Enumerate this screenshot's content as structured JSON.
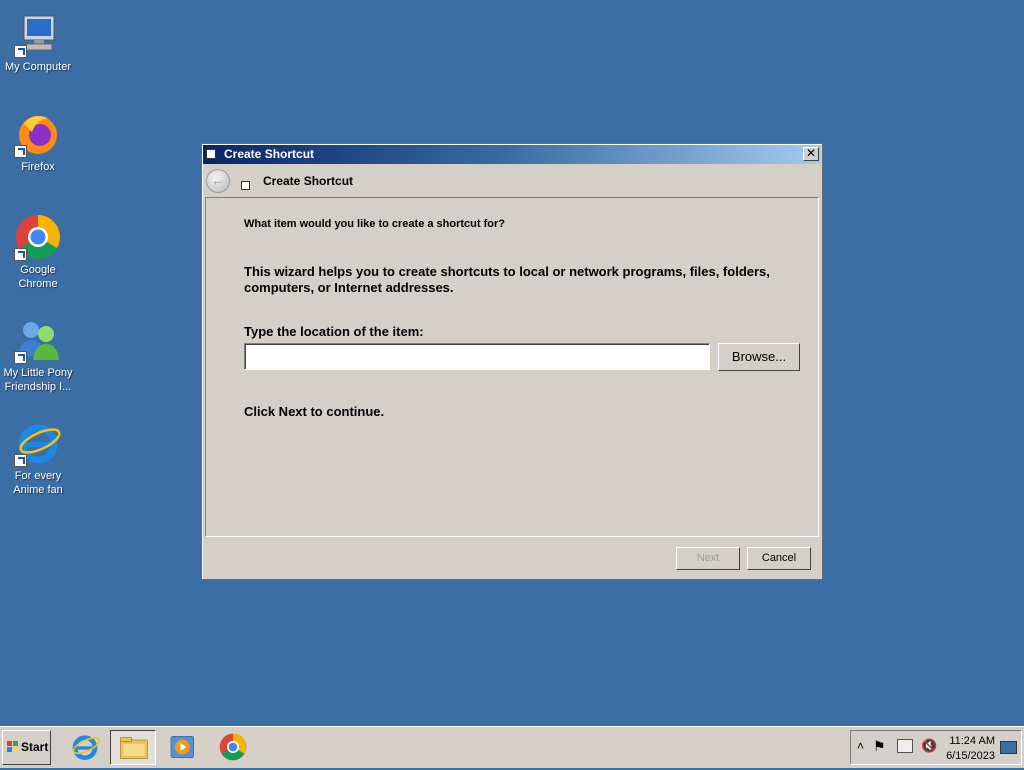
{
  "desktop": {
    "icons": [
      {
        "label": "My Computer",
        "icon": "computer-icon"
      },
      {
        "label": "Firefox",
        "icon": "firefox-icon"
      },
      {
        "label": "Google Chrome",
        "icon": "chrome-icon"
      },
      {
        "label": "My Little Pony Friendship I...",
        "icon": "users-icon"
      },
      {
        "label": "For every Anime fan",
        "icon": "internet-explorer-icon"
      }
    ]
  },
  "dialog": {
    "title": "Create Shortcut",
    "close_label": "✕",
    "nav_title": "Create Shortcut",
    "question": "What item would you like to create a shortcut for?",
    "description": "This wizard helps you to create shortcuts to local or network programs, files, folders, computers, or Internet addresses.",
    "location_label": "Type the location of the item:",
    "location_value": "",
    "browse_label": "Browse...",
    "continue_text": "Click Next to continue.",
    "next_label": "Next",
    "cancel_label": "Cancel"
  },
  "taskbar": {
    "start_label": "Start",
    "apps": [
      "internet-explorer-icon",
      "folder-icon",
      "media-player-icon",
      "chrome-icon"
    ],
    "time": "11:24 AM",
    "date": "6/15/2023"
  },
  "colors": {
    "desktop": "#3a6ea5",
    "title_start": "#0a246a",
    "title_end": "#a6caf0",
    "face": "#d4d0c8"
  }
}
